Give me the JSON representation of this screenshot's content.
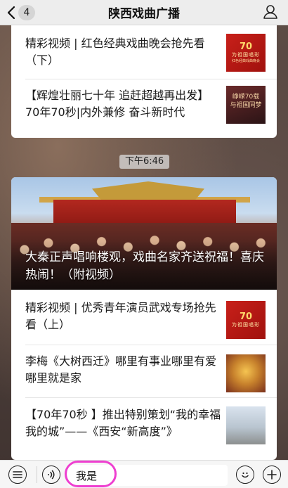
{
  "navbar": {
    "unread_count": "4",
    "title": "陕西戏曲广播"
  },
  "card_top": {
    "items": [
      {
        "text": "精彩视频 | 红色经典戏曲晚会抢先看（下）",
        "thumb_caption": "70",
        "thumb_sub": "为祖国唱彩",
        "thumb_note": "红色经典戏曲晚会"
      },
      {
        "text": "【辉煌壮丽七十年 追赶超越再出发】70年70秒|内外兼修 奋斗新时代",
        "thumb_caption": "峥嵘70载 与祖国同梦"
      }
    ]
  },
  "timestamp": "下午6:46",
  "card_bottom": {
    "hero_headline": "大秦正声唱响楼观，戏曲名家齐送祝福！喜庆热闹！（附视频）",
    "items": [
      {
        "text": "精彩视频 | 优秀青年演员武戏专场抢先看（上）",
        "thumb_caption": "70",
        "thumb_sub": "为祖国唱彩"
      },
      {
        "text": "李梅《大树西迁》哪里有事业哪里有爱哪里就是家"
      },
      {
        "text": "【70年70秒 】推出特别策划“我的幸福我的城”——《西安“新高度”》"
      }
    ]
  },
  "input": {
    "value": "我是"
  },
  "colors": {
    "highlight": "#ee3fd0",
    "navbar_bg": "#ededed"
  }
}
